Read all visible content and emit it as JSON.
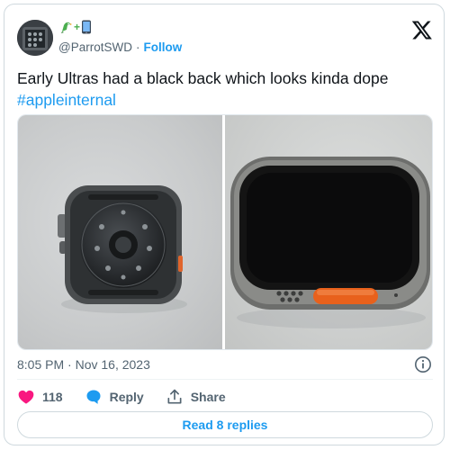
{
  "author": {
    "name_emoji": [
      "🦜",
      "+",
      "📱"
    ],
    "handle": "@ParrotSWD",
    "separator": "·",
    "follow_label": "Follow"
  },
  "tweet": {
    "text": "Early Ultras had a black back which looks kinda dope",
    "hashtag": "#appleinternal",
    "timestamp": "8:05 PM · Nov 16, 2023"
  },
  "actions": {
    "like_count": "118",
    "reply_label": "Reply",
    "share_label": "Share"
  },
  "read_replies_label": "Read 8 replies",
  "colors": {
    "accent": "#1d9bf0",
    "like": "#f91880",
    "text": "#0f1419",
    "muted": "#536471",
    "border": "#cfd9de"
  },
  "icons": [
    "x-logo-icon",
    "info-icon",
    "heart-icon",
    "reply-bubble-icon",
    "share-icon"
  ]
}
